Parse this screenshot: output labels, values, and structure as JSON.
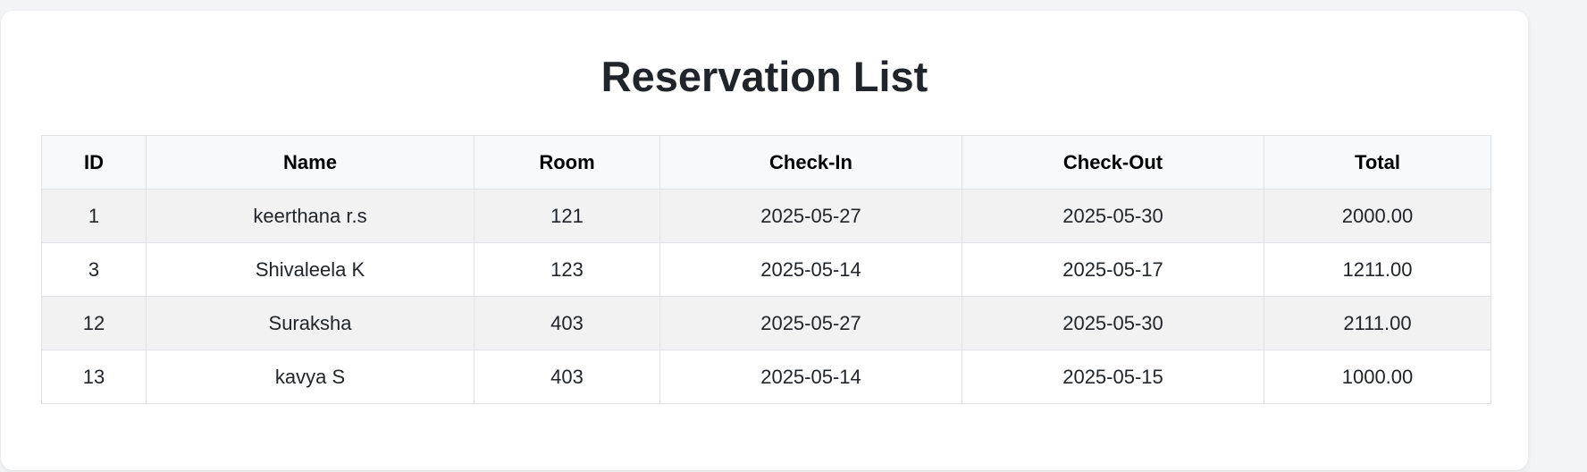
{
  "page": {
    "title": "Reservation List"
  },
  "table": {
    "columns": [
      "ID",
      "Name",
      "Room",
      "Check-In",
      "Check-Out",
      "Total"
    ],
    "rows": [
      [
        "1",
        "keerthana r.s",
        "121",
        "2025-05-27",
        "2025-05-30",
        "2000.00"
      ],
      [
        "3",
        "Shivaleela K",
        "123",
        "2025-05-14",
        "2025-05-17",
        "1211.00"
      ],
      [
        "12",
        "Suraksha",
        "403",
        "2025-05-27",
        "2025-05-30",
        "2111.00"
      ],
      [
        "13",
        "kavya S",
        "403",
        "2025-05-14",
        "2025-05-15",
        "1000.00"
      ]
    ]
  },
  "colors": {
    "header_bg": "#f8f9fa",
    "stripe_bg": "#f2f2f2",
    "border": "#dee2e6",
    "page_bg": "#f3f4f6"
  }
}
